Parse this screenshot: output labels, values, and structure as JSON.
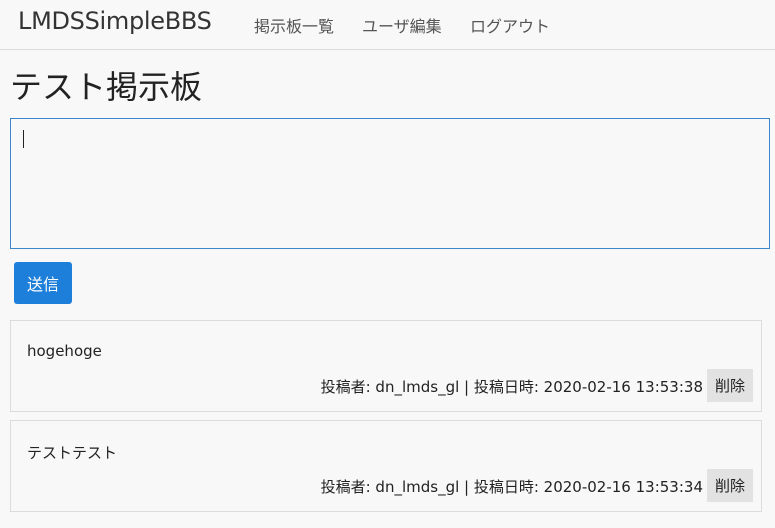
{
  "navbar": {
    "brand": "LMDSSimpleBBS",
    "links": [
      "掲示板一覧",
      "ユーザ編集",
      "ログアウト"
    ]
  },
  "page": {
    "title": "テスト掲示板"
  },
  "composer": {
    "value": "",
    "submit_label": "送信"
  },
  "posts": [
    {
      "body": "hogehoge",
      "meta": "投稿者: dn_lmds_gl | 投稿日時: 2020-02-16 13:53:38",
      "delete_label": "削除"
    },
    {
      "body": "テストテスト",
      "meta": "投稿者: dn_lmds_gl | 投稿日時: 2020-02-16 13:53:34",
      "delete_label": "削除"
    }
  ],
  "colors": {
    "accent": "#1d7fd9",
    "input_focus_border": "#3b86c8",
    "delete_button_bg": "#e2e2e2"
  }
}
